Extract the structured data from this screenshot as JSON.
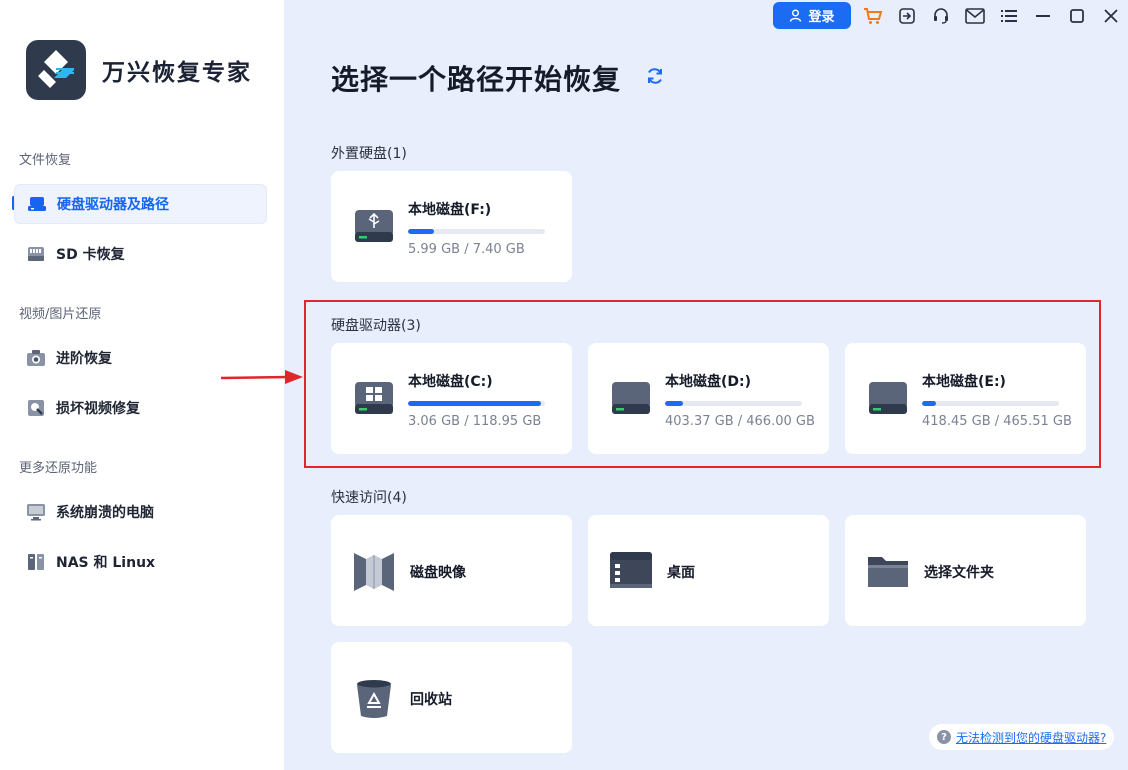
{
  "app": {
    "name": "万兴恢复专家"
  },
  "topbar": {
    "login_label": "登录",
    "icons": [
      "cart-icon",
      "sign-in-icon",
      "headset-icon",
      "mail-icon",
      "menu-icon",
      "minimize-icon",
      "maximize-icon",
      "close-icon"
    ]
  },
  "sidebar": {
    "sections": [
      {
        "title": "文件恢复",
        "items": [
          {
            "label": "硬盘驱动器及路径",
            "icon": "hard-drive-icon",
            "active": true
          },
          {
            "label": "SD 卡恢复",
            "icon": "sd-card-icon",
            "active": false
          }
        ]
      },
      {
        "title": "视频/图片还原",
        "items": [
          {
            "label": "进阶恢复",
            "icon": "camera-icon",
            "active": false
          },
          {
            "label": "损坏视频修复",
            "icon": "video-repair-icon",
            "active": false
          }
        ]
      },
      {
        "title": "更多还原功能",
        "items": [
          {
            "label": "系统崩溃的电脑",
            "icon": "monitor-icon",
            "active": false
          },
          {
            "label": "NAS 和 Linux",
            "icon": "nas-icon",
            "active": false
          }
        ]
      }
    ]
  },
  "main": {
    "title": "选择一个路径开始恢复",
    "external": {
      "title": "外置硬盘(1)",
      "drives": [
        {
          "name": "本地磁盘(F:)",
          "size": "5.99 GB / 7.40 GB",
          "used_fraction": 0.19,
          "icon": "usb-drive-icon"
        }
      ]
    },
    "internal": {
      "title": "硬盘驱动器(3)",
      "drives": [
        {
          "name": "本地磁盘(C:)",
          "size": "3.06 GB / 118.95 GB",
          "used_fraction": 0.97,
          "icon": "windows-drive-icon"
        },
        {
          "name": "本地磁盘(D:)",
          "size": "403.37 GB / 466.00 GB",
          "used_fraction": 0.13,
          "icon": "drive-icon"
        },
        {
          "name": "本地磁盘(E:)",
          "size": "418.45 GB / 465.51 GB",
          "used_fraction": 0.1,
          "icon": "drive-icon"
        }
      ]
    },
    "quick": {
      "title": "快速访问(4)",
      "items": [
        {
          "label": "磁盘映像",
          "icon": "disk-image-icon"
        },
        {
          "label": "桌面",
          "icon": "desktop-icon"
        },
        {
          "label": "选择文件夹",
          "icon": "folder-icon"
        },
        {
          "label": "回收站",
          "icon": "recycle-bin-icon"
        }
      ]
    },
    "help_link": "无法检测到您的硬盘驱动器?"
  },
  "colors": {
    "accent": "#1b6cf2",
    "highlight": "#e0252c",
    "background": "#e8eefb"
  }
}
